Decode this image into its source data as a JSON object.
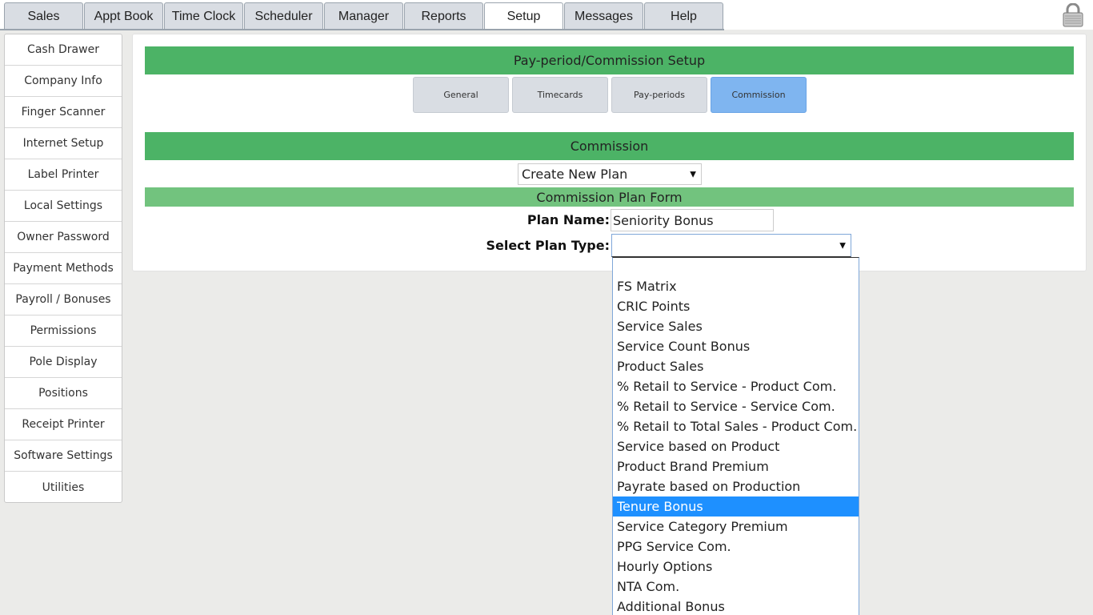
{
  "nav": {
    "tabs": [
      {
        "label": "Sales"
      },
      {
        "label": "Appt Book"
      },
      {
        "label": "Time Clock"
      },
      {
        "label": "Scheduler"
      },
      {
        "label": "Manager"
      },
      {
        "label": "Reports"
      },
      {
        "label": "Setup"
      },
      {
        "label": "Messages"
      },
      {
        "label": "Help"
      }
    ],
    "active_tab": "Setup",
    "lock_icon": "padlock-icon"
  },
  "sidebar": {
    "items": [
      {
        "label": "Cash Drawer"
      },
      {
        "label": "Company Info"
      },
      {
        "label": "Finger Scanner"
      },
      {
        "label": "Internet Setup"
      },
      {
        "label": "Label Printer"
      },
      {
        "label": "Local Settings"
      },
      {
        "label": "Owner Password"
      },
      {
        "label": "Payment Methods"
      },
      {
        "label": "Payroll / Bonuses"
      },
      {
        "label": "Permissions"
      },
      {
        "label": "Pole Display"
      },
      {
        "label": "Positions"
      },
      {
        "label": "Receipt Printer"
      },
      {
        "label": "Software Settings"
      },
      {
        "label": "Utilities"
      }
    ]
  },
  "main": {
    "header": "Pay-period/Commission Setup",
    "subtabs": [
      {
        "label": "General"
      },
      {
        "label": "Timecards"
      },
      {
        "label": "Pay-periods"
      },
      {
        "label": "Commission"
      }
    ],
    "active_subtab": "Commission",
    "section_title": "Commission",
    "plan_select_value": "Create New Plan",
    "form_title": "Commission Plan Form",
    "plan_name_label": "Plan Name:",
    "plan_name_value": "Seniority Bonus",
    "plan_type_label": "Select Plan Type:",
    "plan_type_value": ""
  },
  "dropdown": {
    "options": [
      {
        "label": ""
      },
      {
        "label": "FS Matrix"
      },
      {
        "label": "CRIC Points"
      },
      {
        "label": "Service Sales"
      },
      {
        "label": "Service Count Bonus"
      },
      {
        "label": "Product Sales"
      },
      {
        "label": "% Retail to Service - Product Com."
      },
      {
        "label": "% Retail to Service - Service Com."
      },
      {
        "label": "% Retail to Total Sales - Product Com."
      },
      {
        "label": "Service based on Product"
      },
      {
        "label": "Product Brand Premium"
      },
      {
        "label": "Payrate based on Production"
      },
      {
        "label": "Tenure Bonus"
      },
      {
        "label": "Service Category Premium"
      },
      {
        "label": "PPG Service Com."
      },
      {
        "label": "Hourly Options"
      },
      {
        "label": "NTA Com."
      },
      {
        "label": "Additional Bonus"
      }
    ],
    "highlighted": "Tenure Bonus"
  },
  "colors": {
    "header_green": "#4cb366",
    "form_green": "#72c37e",
    "active_subtab": "#7fb5f0",
    "highlight": "#1e90ff"
  }
}
